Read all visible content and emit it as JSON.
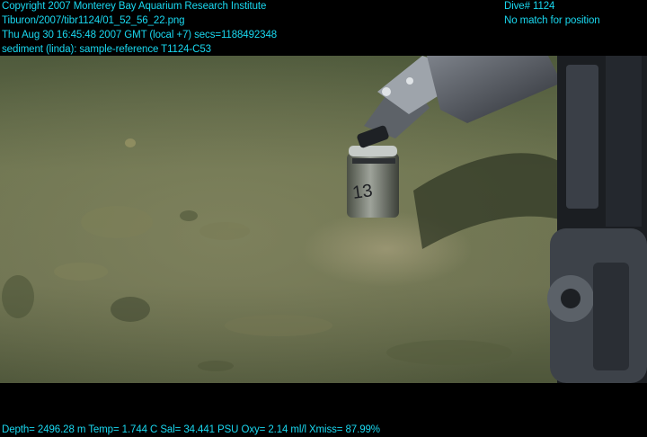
{
  "header": {
    "copyright": "Copyright 2007 Monterey Bay Aquarium Research Institute",
    "file_path": "Tiburon/2007/tibr1124/01_52_56_22.png",
    "timestamp": "Thu Aug 30 16:45:48 2007 GMT (local +7)  secs=1188492348",
    "annotation": "sediment (linda): sample-reference T1124-C53",
    "dive": "Dive# 1124",
    "position_status": "No match for position"
  },
  "footer": {
    "telemetry": "Depth= 2496.28 m  Temp= 1.744 C  Sal= 34.441 PSU  Oxy= 2.14 ml/l  Xmiss= 87.99%"
  },
  "scene": {
    "core_label": "13"
  },
  "colors": {
    "overlay_text": "#19d8f0",
    "seafloor": "#6f7550",
    "background": "#000000"
  }
}
